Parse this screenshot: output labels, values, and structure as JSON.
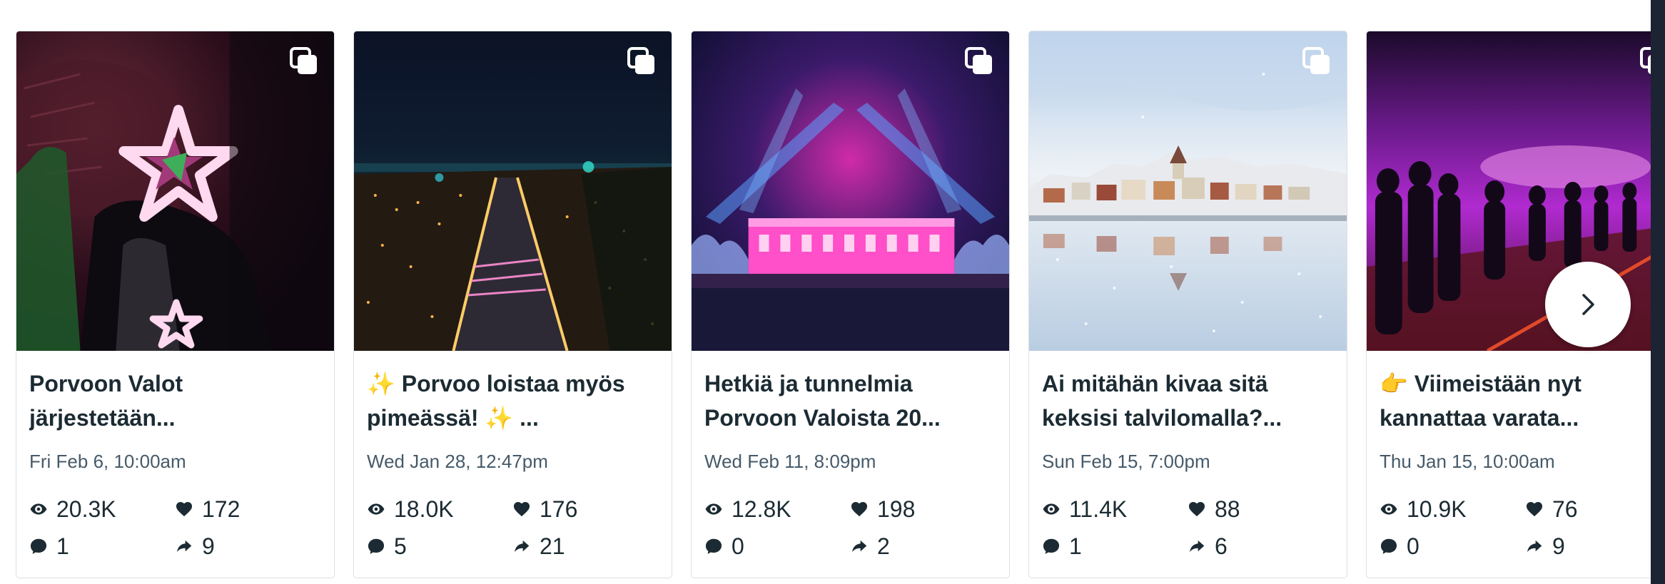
{
  "posts": [
    {
      "title": "Porvoon Valot järjestetään...",
      "date": "Fri Feb 6, 10:00am",
      "views": "20.3K",
      "likes": "172",
      "comments": "1",
      "shares": "9",
      "image_desc": "person with star stickers in dark red lit tunnel"
    },
    {
      "title": "✨ Porvoo loistaa myös pimeässä! ✨ ...",
      "date": "Wed Jan 28, 12:47pm",
      "views": "18.0K",
      "likes": "176",
      "comments": "5",
      "shares": "21",
      "image_desc": "aerial night view of Porvoo with lights"
    },
    {
      "title": "Hetkiä ja tunnelmia Porvoon Valoista 20...",
      "date": "Wed Feb 11, 8:09pm",
      "views": "12.8K",
      "likes": "198",
      "comments": "0",
      "shares": "2",
      "image_desc": "pink illuminated building with blue spotlights"
    },
    {
      "title": "Ai mitähän kivaa sitä keksisi talvilomalla?...",
      "date": "Sun Feb 15, 7:00pm",
      "views": "11.4K",
      "likes": "88",
      "comments": "1",
      "shares": "6",
      "image_desc": "snowy old town reflected in frozen river"
    },
    {
      "title": "👉 Viimeistään nyt kannattaa varata...",
      "date": "Thu Jan 15, 10:00am",
      "views": "10.9K",
      "likes": "76",
      "comments": "0",
      "shares": "9",
      "image_desc": "crowd silhouettes in purple light fog"
    }
  ],
  "icons": {
    "views": "eye-icon",
    "likes": "heart-icon",
    "comments": "comment-icon",
    "shares": "share-icon",
    "multi": "multiple-photos-icon",
    "next": "chevron-right-icon"
  },
  "colors": {
    "text": "#1c2b33",
    "muted": "#465a69",
    "frame": "#1c2333"
  }
}
